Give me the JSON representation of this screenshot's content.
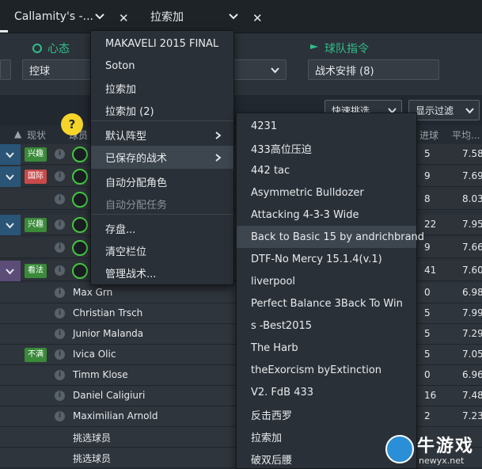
{
  "tabs": [
    {
      "label": "Callamity's -..."
    },
    {
      "label": "拉索加"
    }
  ],
  "header": {
    "mentality": {
      "title": "心态",
      "value": "控球"
    },
    "team_instructions": {
      "title": "球队指令",
      "value": "战术安排 (8)"
    }
  },
  "toolbar": {
    "quick_pick": "快速挑选",
    "view_filter": "显示过滤"
  },
  "columns": {
    "status": "现状",
    "player": "球员",
    "goals": "进球",
    "avg": "平均..."
  },
  "help_label": "?",
  "rows": [
    {
      "badge": "兴趣",
      "badge_color": "#3a8a3a",
      "name": "",
      "v1": "5",
      "v2": "7.58"
    },
    {
      "badge": "国际",
      "badge_color": "#c84a4a",
      "name": "",
      "v1": "9",
      "v2": "7.69"
    },
    {
      "badge": "",
      "badge_color": "",
      "name": "",
      "v1": "8",
      "v2": "8.03"
    },
    {
      "badge": "兴趣",
      "badge_color": "#3a8a3a",
      "name": "",
      "v1": "22",
      "v2": "7.95"
    },
    {
      "badge": "",
      "badge_color": "",
      "name": "",
      "v1": "9",
      "v2": "7.66"
    },
    {
      "badge": "看法",
      "badge_color": "#3a8a3a",
      "name": "",
      "v1": "41",
      "v2": "7.60"
    },
    {
      "badge": "",
      "badge_color": "",
      "name": "Max Grn",
      "v1": "0",
      "v2": "6.98"
    },
    {
      "badge": "",
      "badge_color": "",
      "name": "Christian Trsch",
      "v1": "5",
      "v2": "7.99"
    },
    {
      "badge": "",
      "badge_color": "",
      "name": "Junior Malanda",
      "v1": "5",
      "v2": "7.29"
    },
    {
      "badge": "不满",
      "badge_color": "#3a8a3a",
      "name": "Ivica Olic",
      "v1": "5",
      "v2": "7.05"
    },
    {
      "badge": "",
      "badge_color": "",
      "name": "Timm Klose",
      "v1": "0",
      "v2": "6.96"
    },
    {
      "badge": "",
      "badge_color": "",
      "name": "Daniel Caligiuri",
      "v1": "16",
      "v2": "7.48"
    },
    {
      "badge": "",
      "badge_color": "",
      "name": "Maximilian Arnold",
      "v1": "2",
      "v2": "7.23"
    },
    {
      "badge": "",
      "badge_color": "",
      "name": "挑选球员",
      "v1": "",
      "v2": ""
    },
    {
      "badge": "",
      "badge_color": "",
      "name": "挑选球员",
      "v1": "",
      "v2": ""
    }
  ],
  "menu": {
    "items": [
      "MAKAVELI 2015 FINAL",
      "Soton",
      "拉索加",
      "拉索加 (2)",
      "默认阵型",
      "已保存的战术",
      "自动分配角色",
      "自动分配任务",
      "存盘...",
      "清空栏位",
      "管理战术..."
    ]
  },
  "submenu": {
    "items": [
      "4231",
      "433高位压迫",
      "442 tac",
      "Asymmetric Bulldozer",
      "Attacking 4-3-3 Wide",
      "Back to Basic 15 by andrichbrand",
      "DTF-No Mercy 15.1.4(v.1)",
      "liverpool",
      "Perfect Balance 3Back To Win",
      "s -Best2015",
      "The Harb",
      "theExorcism byExtinction",
      "V2. FdB 433",
      "反击西罗",
      "拉索加",
      "破双后腰"
    ]
  },
  "watermark": {
    "text": "牛游戏",
    "url": "newyx.net"
  },
  "colors": {
    "accent_green": "#2fbf8c",
    "selection_blue": "#2a5576"
  }
}
